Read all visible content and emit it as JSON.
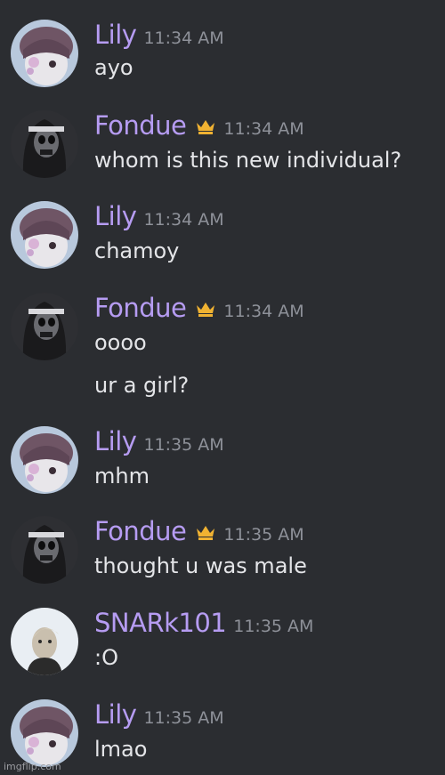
{
  "messages": [
    {
      "user": "Lily",
      "time": "11:34 AM",
      "lines": [
        "ayo"
      ]
    },
    {
      "user": "Fondue",
      "time": "11:34 AM",
      "lines": [
        "whom is this new individual?"
      ]
    },
    {
      "user": "Lily",
      "time": "11:34 AM",
      "lines": [
        "chamoy"
      ]
    },
    {
      "user": "Fondue",
      "time": "11:34 AM",
      "lines": [
        "oooo",
        "ur a girl?"
      ]
    },
    {
      "user": "Lily",
      "time": "11:35 AM",
      "lines": [
        "mhm"
      ]
    },
    {
      "user": "Fondue",
      "time": "11:35 AM",
      "lines": [
        "thought u was male"
      ]
    },
    {
      "user": "SNARk101",
      "time": "11:35 AM",
      "lines": [
        ":O"
      ]
    },
    {
      "user": "Lily",
      "time": "11:35 AM",
      "lines": [
        "lmao"
      ]
    }
  ],
  "watermark": "imgflip.com",
  "colors": {
    "background": "#2b2d31",
    "username": "#b69cf2",
    "timestamp": "#8e9199",
    "text": "#e4e5e8",
    "crown": "#f0b232"
  },
  "icons": {
    "owner_badge": "crown-icon"
  }
}
